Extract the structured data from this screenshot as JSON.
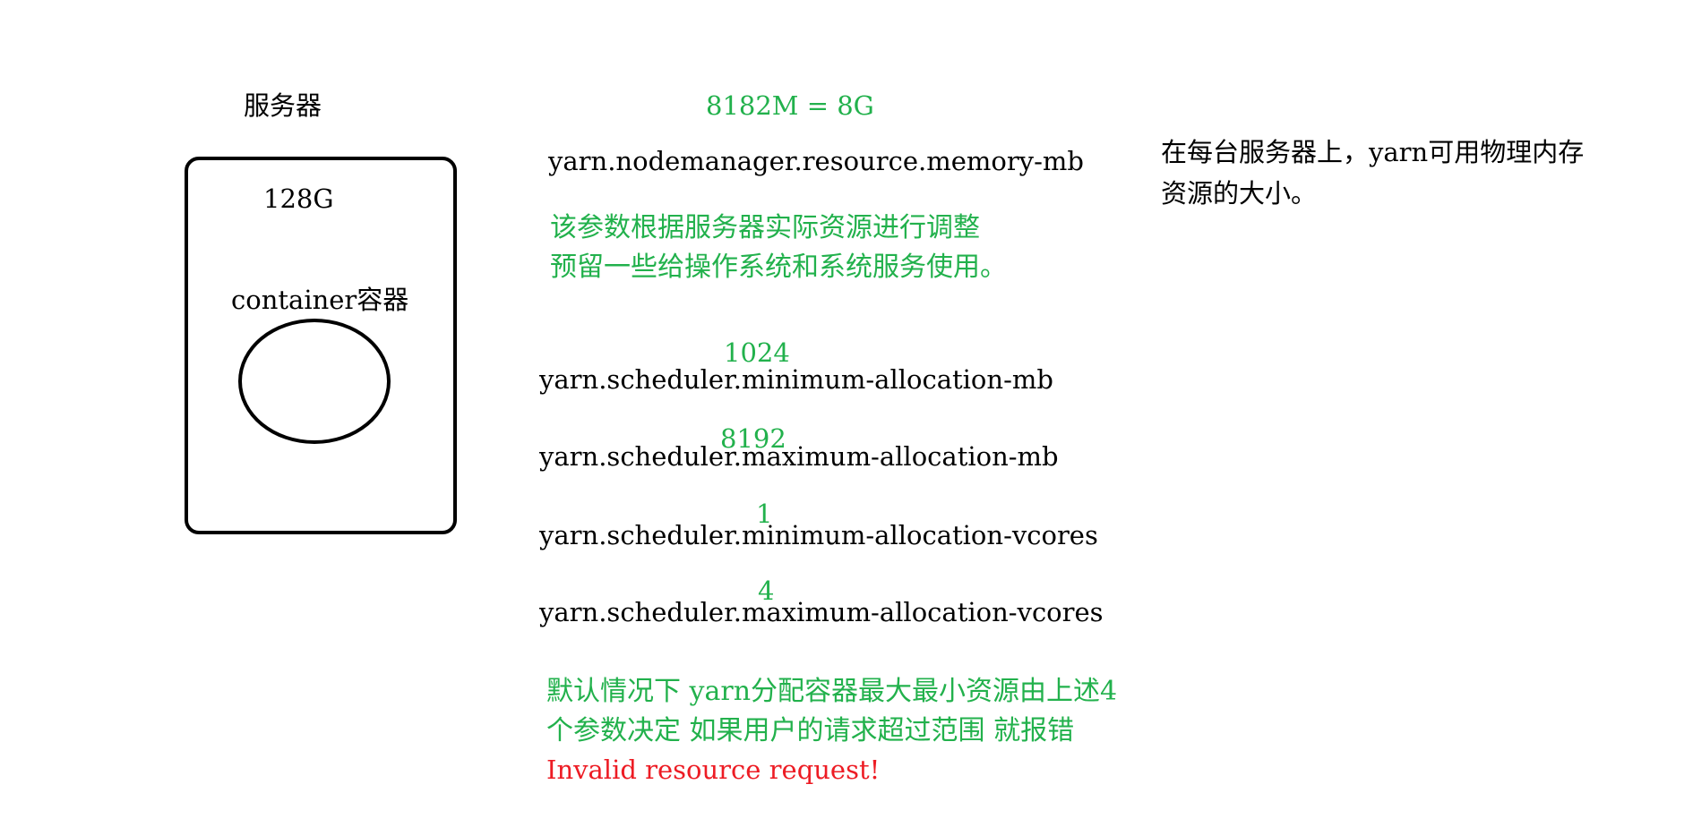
{
  "colors": {
    "text": "#000000",
    "note_green": "#22b14c",
    "error_red": "#ed1c24"
  },
  "server": {
    "title": "服务器",
    "memory": "128G",
    "container_label": "container容器"
  },
  "memory_equation": "8182M = 8G",
  "nodemanager": {
    "param": "yarn.nodemanager.resource.memory-mb",
    "description_line1": "在每台服务器上，yarn可用物理内存",
    "description_line2": "资源的大小。",
    "note_line1": "该参数根据服务器实际资源进行调整",
    "note_line2": "预留一些给操作系统和系统服务使用。"
  },
  "scheduler_params": [
    {
      "value": "1024",
      "param": "yarn.scheduler.minimum-allocation-mb"
    },
    {
      "value": "8192",
      "param": "yarn.scheduler.maximum-allocation-mb"
    },
    {
      "value": "1",
      "param": "yarn.scheduler.minimum-allocation-vcores"
    },
    {
      "value": "4",
      "param": "yarn.scheduler.maximum-allocation-vcores"
    }
  ],
  "summary": {
    "line1": "默认情况下 yarn分配容器最大最小资源由上述4",
    "line2": "个参数决定  如果用户的请求超过范围 就报错",
    "error": "Invalid resource request!"
  }
}
